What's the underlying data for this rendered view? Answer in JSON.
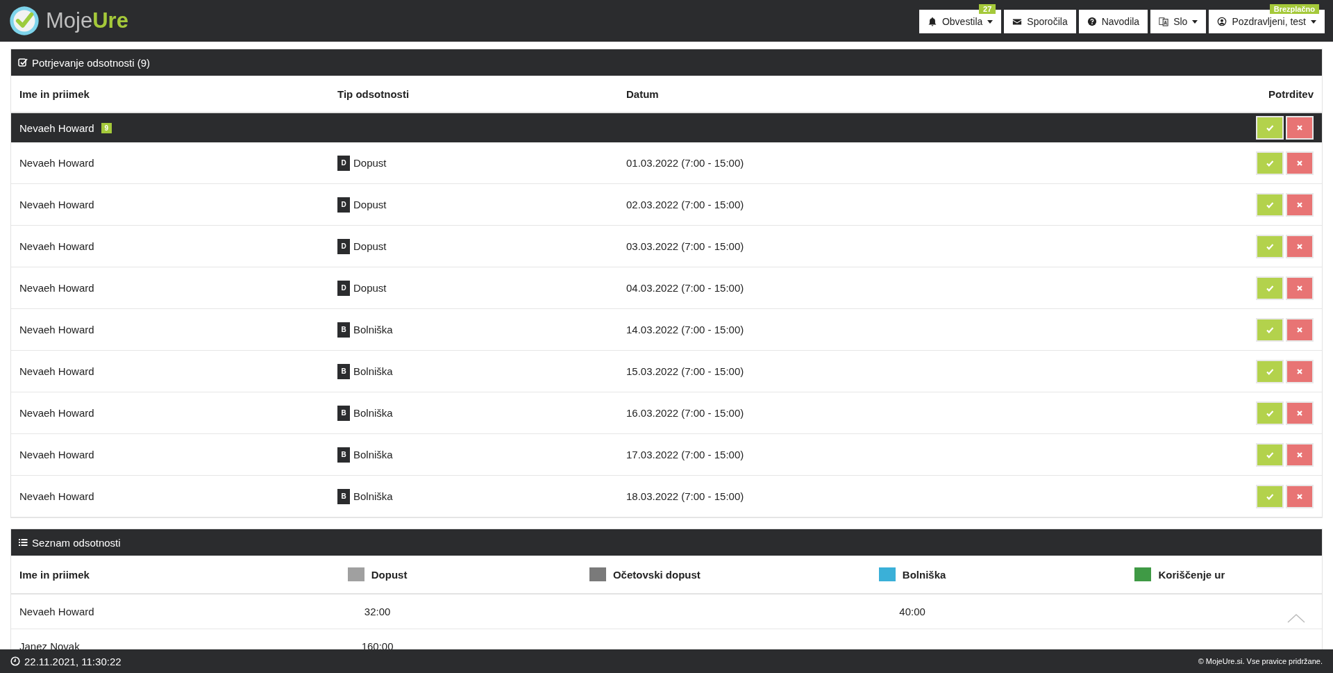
{
  "header": {
    "logo": {
      "first": "Moje",
      "second": "Ure"
    },
    "nav": [
      {
        "kind": "bell",
        "label": "Obvestila",
        "caret": true,
        "badge": "27"
      },
      {
        "kind": "envelope",
        "label": "Sporočila",
        "caret": false
      },
      {
        "kind": "question",
        "label": "Navodila",
        "caret": false
      },
      {
        "kind": "language",
        "label": "Slo",
        "caret": true
      },
      {
        "kind": "user",
        "label": "Pozdravljeni, test",
        "caret": true,
        "badge": "Brezplačno"
      }
    ]
  },
  "approvals": {
    "title": "Potrjevanje odsotnosti (9)",
    "columns": [
      "Ime in priimek",
      "Tip odsotnosti",
      "Datum",
      "Potrditev"
    ],
    "group": {
      "name": "Nevaeh Howard",
      "count": "9"
    },
    "rows": [
      {
        "name": "Nevaeh Howard",
        "type_code": "D",
        "type": "Dopust",
        "date": "01.03.2022 (7:00 - 15:00)"
      },
      {
        "name": "Nevaeh Howard",
        "type_code": "D",
        "type": "Dopust",
        "date": "02.03.2022 (7:00 - 15:00)"
      },
      {
        "name": "Nevaeh Howard",
        "type_code": "D",
        "type": "Dopust",
        "date": "03.03.2022 (7:00 - 15:00)"
      },
      {
        "name": "Nevaeh Howard",
        "type_code": "D",
        "type": "Dopust",
        "date": "04.03.2022 (7:00 - 15:00)"
      },
      {
        "name": "Nevaeh Howard",
        "type_code": "B",
        "type": "Bolniška",
        "date": "14.03.2022 (7:00 - 15:00)"
      },
      {
        "name": "Nevaeh Howard",
        "type_code": "B",
        "type": "Bolniška",
        "date": "15.03.2022 (7:00 - 15:00)"
      },
      {
        "name": "Nevaeh Howard",
        "type_code": "B",
        "type": "Bolniška",
        "date": "16.03.2022 (7:00 - 15:00)"
      },
      {
        "name": "Nevaeh Howard",
        "type_code": "B",
        "type": "Bolniška",
        "date": "17.03.2022 (7:00 - 15:00)"
      },
      {
        "name": "Nevaeh Howard",
        "type_code": "B",
        "type": "Bolniška",
        "date": "18.03.2022 (7:00 - 15:00)"
      }
    ]
  },
  "absence_list": {
    "title": "Seznam odsotnosti",
    "name_column": "Ime in priimek",
    "legend": [
      {
        "label": "Dopust",
        "color": "#a0a0a0"
      },
      {
        "label": "Očetovski dopust",
        "color": "#7a7a7a"
      },
      {
        "label": "Bolniška",
        "color": "#3ab0d8"
      },
      {
        "label": "Koriščenje ur",
        "color": "#3f9a45"
      }
    ],
    "rows": [
      {
        "name": "Nevaeh Howard",
        "col_1": "32:00",
        "col_3": "40:00"
      },
      {
        "name": "Janez Novak",
        "col_1": "160:00"
      }
    ]
  },
  "footer": {
    "clock": "22.11.2021, 11:30:22",
    "copyright": "© MojeUre.si. Vse pravice pridržane."
  }
}
